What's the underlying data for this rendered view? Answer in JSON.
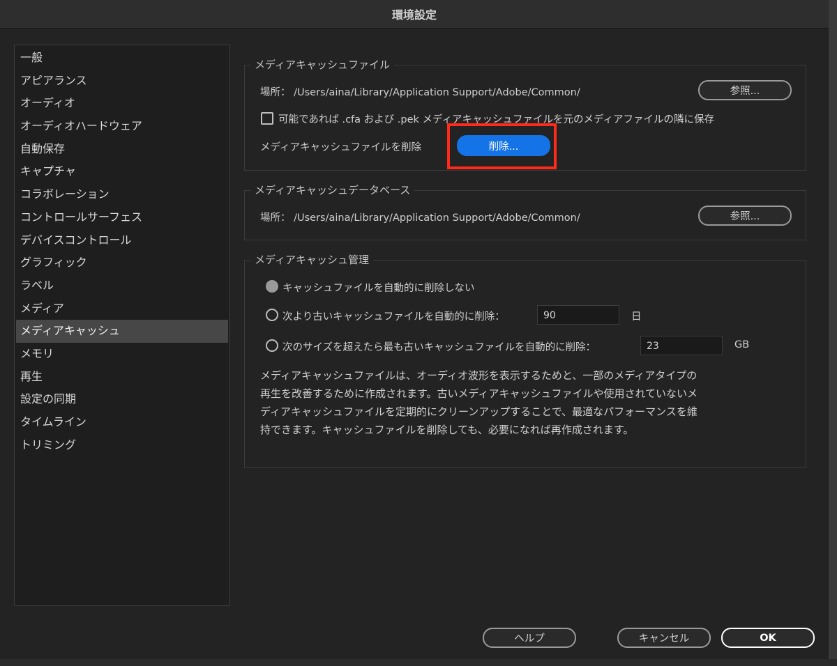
{
  "window": {
    "title": "環境設定"
  },
  "sidebar": {
    "items": [
      {
        "label": "一般"
      },
      {
        "label": "アピアランス"
      },
      {
        "label": "オーディオ"
      },
      {
        "label": "オーディオハードウェア"
      },
      {
        "label": "自動保存"
      },
      {
        "label": "キャプチャ"
      },
      {
        "label": "コラボレーション"
      },
      {
        "label": "コントロールサーフェス"
      },
      {
        "label": "デバイスコントロール"
      },
      {
        "label": "グラフィック"
      },
      {
        "label": "ラベル"
      },
      {
        "label": "メディア"
      },
      {
        "label": "メディアキャッシュ",
        "selected": true
      },
      {
        "label": "メモリ"
      },
      {
        "label": "再生"
      },
      {
        "label": "設定の同期"
      },
      {
        "label": "タイムライン"
      },
      {
        "label": "トリミング"
      }
    ]
  },
  "cache_files": {
    "title": "メディアキャッシュファイル",
    "location_label": "場所：",
    "location_path": "/Users/aina/Library/Application Support/Adobe/Common/",
    "browse_label": "参照...",
    "save_next_to_media_label": "可能であれば .cfa および .pek メディアキャッシュファイルを元のメディアファイルの隣に保存",
    "save_next_to_media_checked": false,
    "delete_label": "メディアキャッシュファイルを削除",
    "delete_button": "削除..."
  },
  "cache_database": {
    "title": "メディアキャッシュデータベース",
    "location_label": "場所：",
    "location_path": "/Users/aina/Library/Application Support/Adobe/Common/",
    "browse_label": "参照..."
  },
  "cache_management": {
    "title": "メディアキャッシュ管理",
    "option_never": "キャッシュファイルを自動的に削除しない",
    "option_older": "次より古いキャッシュファイルを自動的に削除：",
    "older_value": "90",
    "older_unit": "日",
    "option_size": "次のサイズを超えたら最も古いキャッシュファイルを自動的に削除：",
    "size_value": "23",
    "size_unit": "GB",
    "selected_option": "never",
    "description": "メディアキャッシュファイルは、オーディオ波形を表示するためと、一部のメディアタイプの再生を改善するために作成されます。古いメディアキャッシュファイルや使用されていないメディアキャッシュファイルを定期的にクリーンアップすることで、最適なパフォーマンスを維持できます。キャッシュファイルを削除しても、必要になれば再作成されます。"
  },
  "footer": {
    "help_button": "ヘルプ",
    "cancel_button": "キャンセル",
    "ok_button": "OK"
  },
  "colors": {
    "accent": "#1473e6",
    "highlight": "#ff2a1a"
  }
}
